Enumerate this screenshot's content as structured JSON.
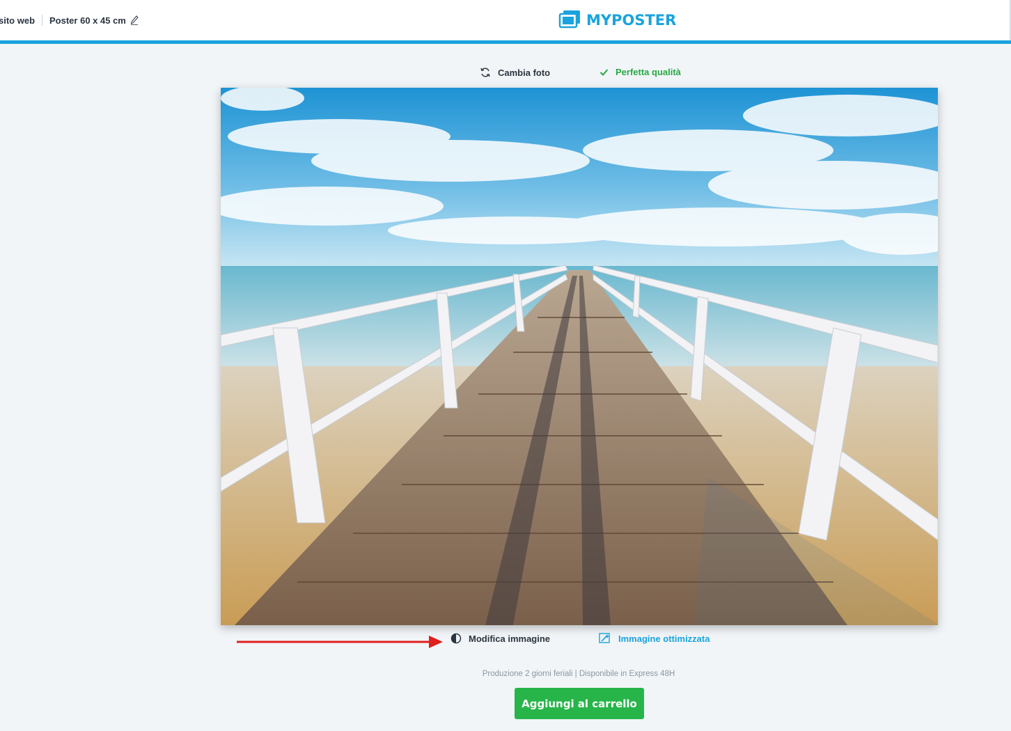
{
  "header": {
    "crumb_web": "sito web",
    "crumb_poster": "Poster 60 x 45 cm",
    "logo_text": "MYPOSTER",
    "accent_color": "#1aa3dd"
  },
  "top_actions": {
    "change_photo": "Cambia foto",
    "quality": "Perfetta qualità",
    "quality_color": "#27a843"
  },
  "bottom_actions": {
    "edit_image": "Modifica immagine",
    "optimized_image": "Immagine ottimizzata"
  },
  "info": {
    "production": "Produzione 2 giorni feriali | Disponibile in Express 48H"
  },
  "cart": {
    "button_label": "Aggiungi al carrello",
    "button_color": "#27b54a"
  },
  "icons": {
    "pencil": "pencil-icon",
    "logo": "myposter-logo-icon",
    "refresh": "refresh-icon",
    "check": "check-icon",
    "contrast": "contrast-icon",
    "magic": "magic-image-icon",
    "arrow": "red-arrow-annotation"
  }
}
